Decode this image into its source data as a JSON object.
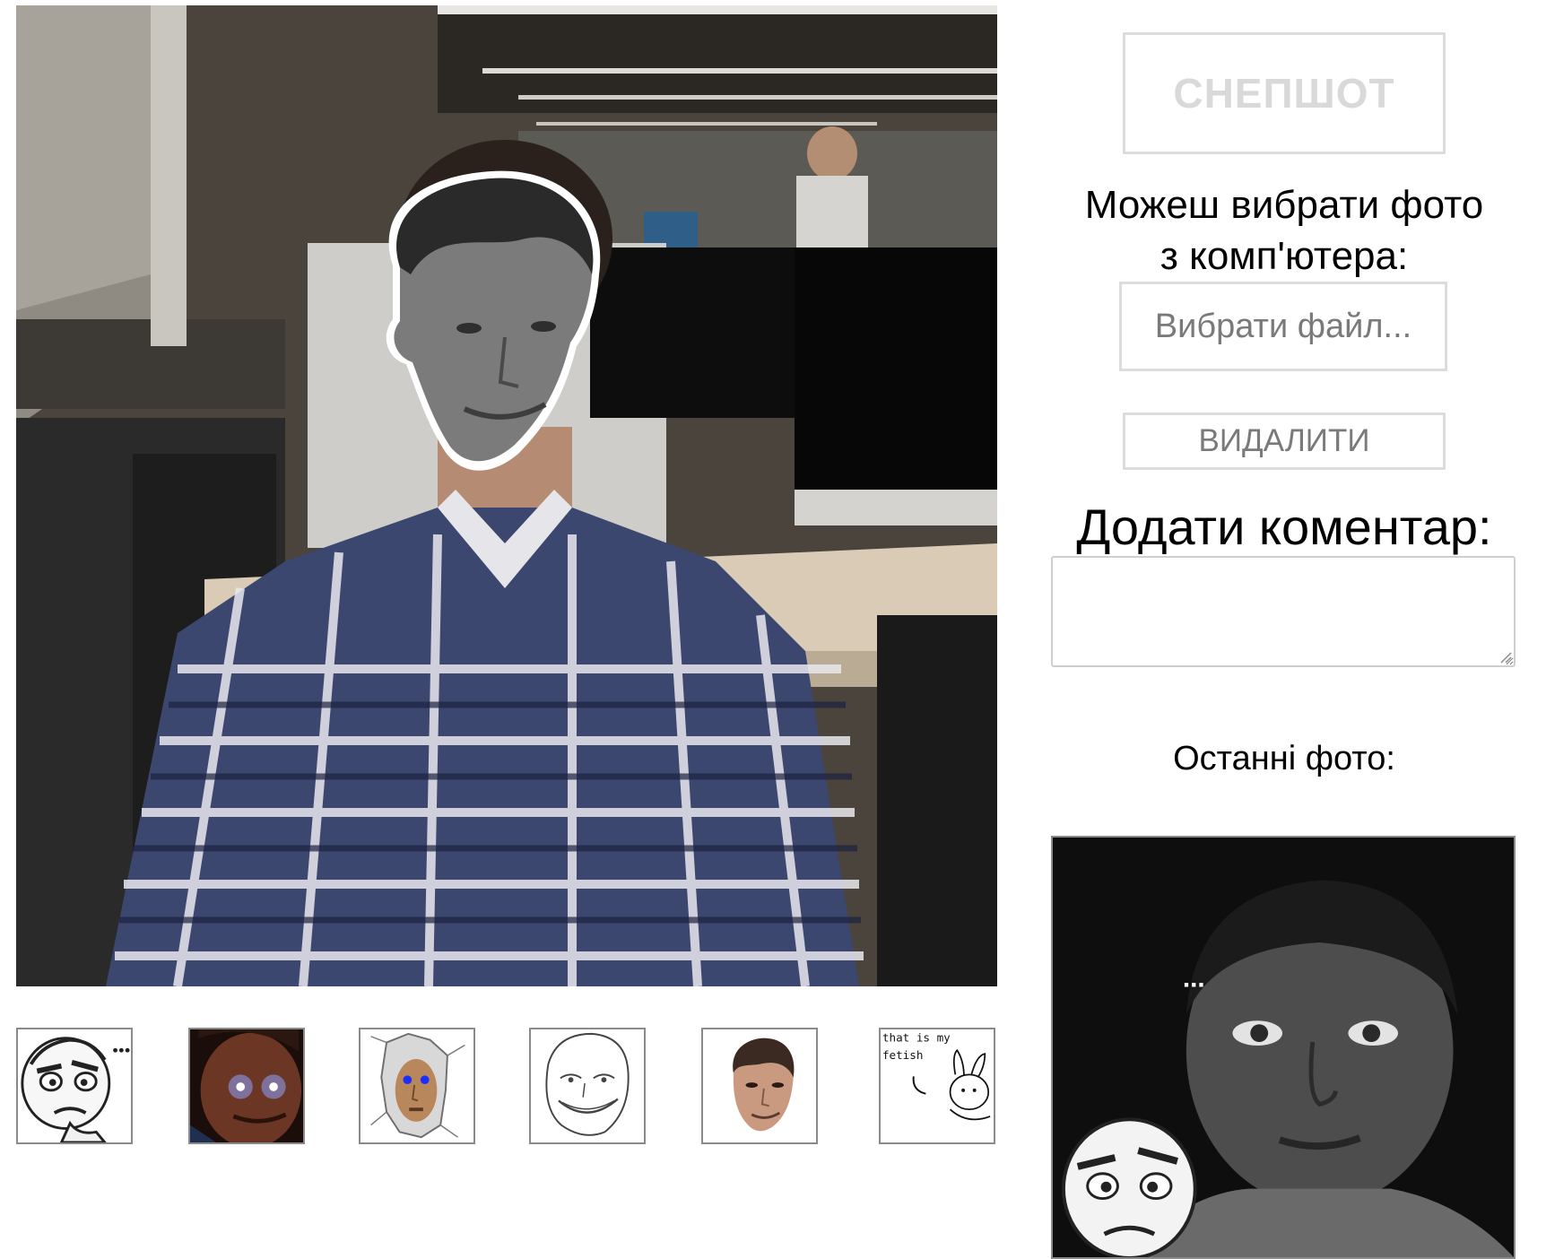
{
  "webcam": {
    "icon": "webcam-video-feed"
  },
  "stickers": [
    {
      "icon": "rage-face-thinking-sticker"
    },
    {
      "icon": "glowing-eyes-face-sticker"
    },
    {
      "icon": "cracked-wall-face-sticker"
    },
    {
      "icon": "grinning-troll-face-sticker"
    },
    {
      "icon": "kappa-face-sticker"
    },
    {
      "icon": "that-is-my-fetish-sticker",
      "caption_line1": "that is my",
      "caption_line2": "fetish"
    }
  ],
  "controls": {
    "snapshot_label": "СНЕПШОТ",
    "choose_photo_line1": "Можеш вибрати фото",
    "choose_photo_line2": "з комп'ютера:",
    "file_button_label": "Вибрати файл...",
    "delete_label": "ВИДАЛИТИ",
    "comment_heading": "Додати коментар:",
    "comment_value": "",
    "recent_label": "Останні фото:"
  },
  "recent_photos": [
    {
      "icon": "recent-photo-with-rage-face",
      "overlay_text": "..."
    }
  ],
  "colors": {
    "button_border": "#dcdcdc",
    "button_text_disabled": "#d9d9d9",
    "button_text": "#7a7a7a",
    "thumbnail_border": "#8a8a8a"
  }
}
